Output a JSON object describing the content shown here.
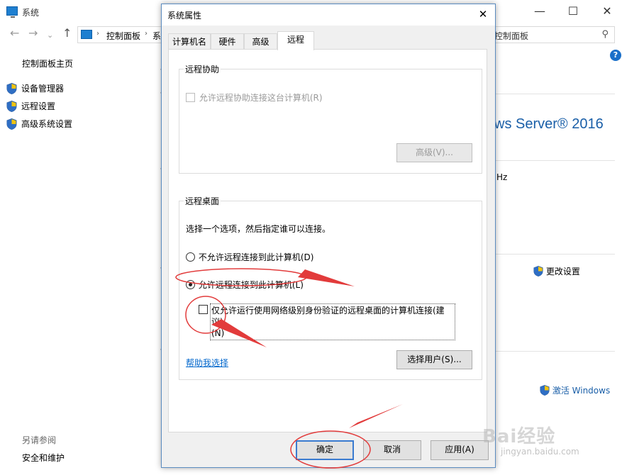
{
  "background_window": {
    "title": "系统",
    "address_part1": "控制面板",
    "address_part2": "系",
    "search_placeholder": "控制面板",
    "sidebar_home": "控制面板主页",
    "sidebar_links": [
      "设备管理器",
      "远程设置",
      "高级系统设置"
    ],
    "see_also": "另请参阅",
    "security_link": "安全和维护",
    "os_name": "ws Server® 2016",
    "hz": "Hz",
    "change_settings": "更改设置",
    "activate_windows": "激活 Windows"
  },
  "dialog": {
    "title": "系统属性",
    "tabs": [
      "计算机名",
      "硬件",
      "高级",
      "远程"
    ],
    "active_tab": "远程",
    "remote_assistance": {
      "group_label": "远程协助",
      "allow_checkbox_label": "允许远程协助连接这台计算机(R)",
      "advanced_button": "高级(V)..."
    },
    "remote_desktop": {
      "group_label": "远程桌面",
      "instruction": "选择一个选项，然后指定谁可以连接。",
      "option_disallow": "不允许远程连接到此计算机(D)",
      "option_allow": "允许远程连接到此计算机(L)",
      "nla_checkbox_line1": "仅允许运行使用网络级别身份验证的远程桌面的计算机连接(建议)",
      "nla_checkbox_line2": "(N)",
      "help_link": "帮助我选择",
      "select_users_button": "选择用户(S)..."
    },
    "ok_button": "确定",
    "cancel_button": "取消",
    "apply_button": "应用(A)"
  },
  "watermark": {
    "brand": "Bai经验",
    "url": "jingyan.baidu.com"
  },
  "colors": {
    "dialog_bg": "#f0f0f0",
    "accent_blue": "#3a7bd0",
    "annotation_red": "#e23b3b",
    "link_blue": "#0066cc"
  }
}
